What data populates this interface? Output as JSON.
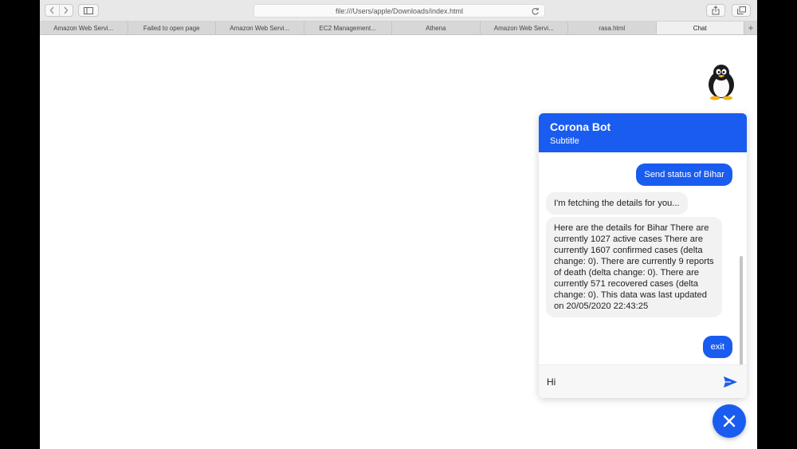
{
  "browser": {
    "address": "file:///Users/apple/Downloads/index.html",
    "tabs": [
      {
        "label": "Amazon Web Servi..."
      },
      {
        "label": "Failed to open page"
      },
      {
        "label": "Amazon Web Servi..."
      },
      {
        "label": "EC2 Management..."
      },
      {
        "label": "Athena"
      },
      {
        "label": "Amazon Web Servi..."
      },
      {
        "label": "rasa.html"
      },
      {
        "label": "Chat"
      }
    ],
    "active_tab": "Chat"
  },
  "chat": {
    "title": "Corona Bot",
    "subtitle": "Subtitle",
    "accent_color": "#1a5cf0",
    "messages": [
      {
        "sender": "user",
        "text": "Send status of Bihar"
      },
      {
        "sender": "bot",
        "text": "I'm fetching the details for you..."
      },
      {
        "sender": "bot",
        "text": "Here are the details for Bihar There are currently 1027 active cases There are currently 1607 confirmed cases (delta change: 0). There are currently 9 reports of death (delta change: 0). There are currently 571 recovered cases (delta change: 0). This data was last updated on 20/05/2020 22:43:25"
      },
      {
        "sender": "user",
        "text": "exit"
      }
    ],
    "input_value": "Hi",
    "send_icon": "send-icon",
    "close_icon": "close-icon"
  }
}
